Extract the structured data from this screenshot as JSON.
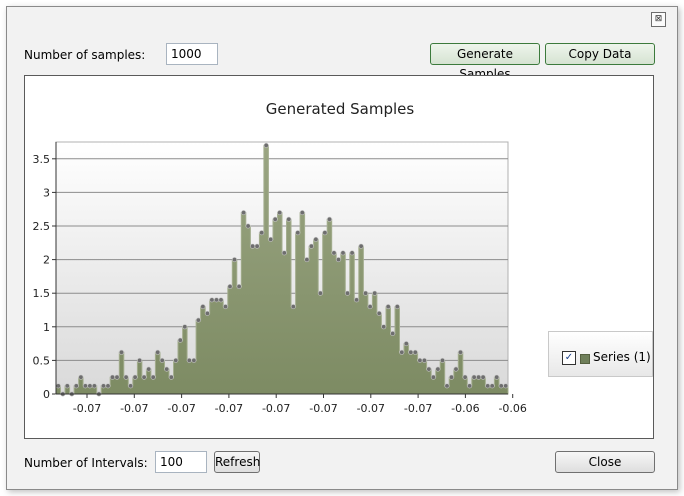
{
  "window": {
    "close_glyph": "⊠"
  },
  "samples": {
    "label": "Number of samples:",
    "value": "1000"
  },
  "buttons": {
    "generate": "Generate Samples",
    "copy": "Copy Data",
    "refresh": "Refresh",
    "close": "Close"
  },
  "intervals": {
    "label": "Number of Intervals:",
    "value": "100"
  },
  "legend": {
    "checked_glyph": "✓",
    "series_name": "Series (1)"
  },
  "colors": {
    "fill": "#7d8b63",
    "stroke": "#a3ad8e",
    "point": "#6e6e6e",
    "grid": "#8c8c8c"
  },
  "chart_data": {
    "type": "area",
    "title": "Generated Samples",
    "xlabel": "",
    "ylabel": "",
    "ylim": [
      0,
      3.75
    ],
    "yticks": [
      0,
      0.5,
      1,
      1.5,
      2,
      2.5,
      3,
      3.5
    ],
    "ytick_labels": [
      "0",
      "0.5",
      "1",
      "1.5",
      "2",
      "2.5",
      "3",
      "3.5"
    ],
    "xtick_labels": [
      "-0.07",
      "-0.07",
      "-0.07",
      "-0.07",
      "-0.07",
      "-0.07",
      "-0.07",
      "-0.07",
      "-0.06",
      "-0.06"
    ],
    "grid": true,
    "legend_position": "right",
    "series": [
      {
        "name": "Series (1)",
        "values": [
          0.12,
          0,
          0.12,
          0,
          0.12,
          0.25,
          0.12,
          0.12,
          0.12,
          0,
          0.12,
          0.12,
          0.25,
          0.25,
          0.62,
          0.25,
          0.12,
          0.25,
          0.5,
          0.25,
          0.37,
          0.25,
          0.62,
          0.5,
          0.37,
          0.25,
          0.5,
          0.8,
          1.0,
          0.5,
          0.5,
          1.1,
          1.3,
          1.2,
          1.4,
          1.4,
          1.4,
          1.3,
          1.6,
          2.0,
          1.6,
          2.7,
          2.5,
          2.2,
          2.2,
          2.4,
          3.7,
          2.3,
          2.6,
          2.7,
          2.1,
          2.6,
          1.3,
          2.4,
          2.7,
          2.0,
          2.2,
          2.3,
          1.5,
          2.4,
          2.6,
          2.1,
          2.0,
          2.1,
          1.5,
          2.1,
          1.4,
          2.2,
          1.5,
          1.3,
          1.5,
          1.2,
          1.0,
          1.3,
          0.9,
          1.3,
          0.62,
          0.75,
          0.62,
          0.62,
          0.5,
          0.5,
          0.37,
          0.25,
          0.37,
          0.5,
          0.12,
          0.25,
          0.37,
          0.62,
          0.25,
          0.12,
          0.25,
          0.25,
          0.25,
          0.12,
          0.12,
          0.25,
          0.12,
          0.12
        ]
      }
    ]
  }
}
